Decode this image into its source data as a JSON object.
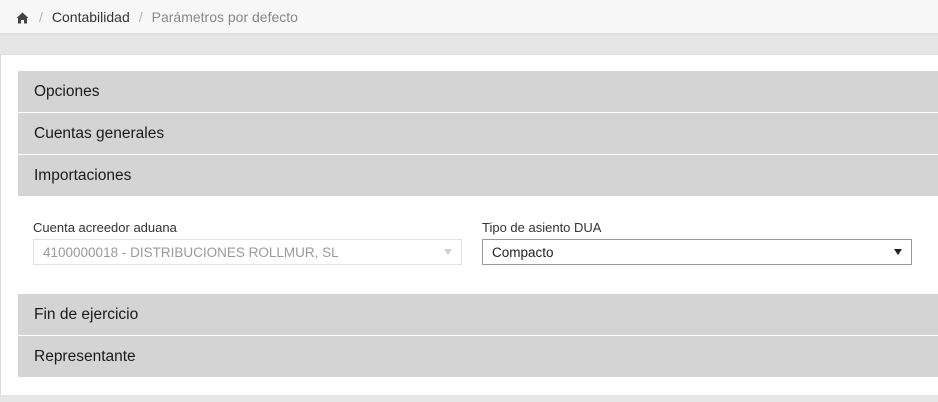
{
  "breadcrumb": {
    "home_icon": "home-icon",
    "items": [
      "Contabilidad",
      "Parámetros por defecto"
    ]
  },
  "accordion": {
    "sections": [
      {
        "label": "Opciones"
      },
      {
        "label": "Cuentas generales"
      },
      {
        "label": "Importaciones"
      },
      {
        "label": "Fin de ejercicio"
      },
      {
        "label": "Representante"
      }
    ],
    "expanded": "Importaciones"
  },
  "importaciones": {
    "cuenta_label": "Cuenta acreedor aduana",
    "cuenta_value": "4100000018 - DISTRIBUCIONES ROLLMUR, SL",
    "tipo_label": "Tipo de asiento DUA",
    "tipo_value": "Compacto"
  }
}
